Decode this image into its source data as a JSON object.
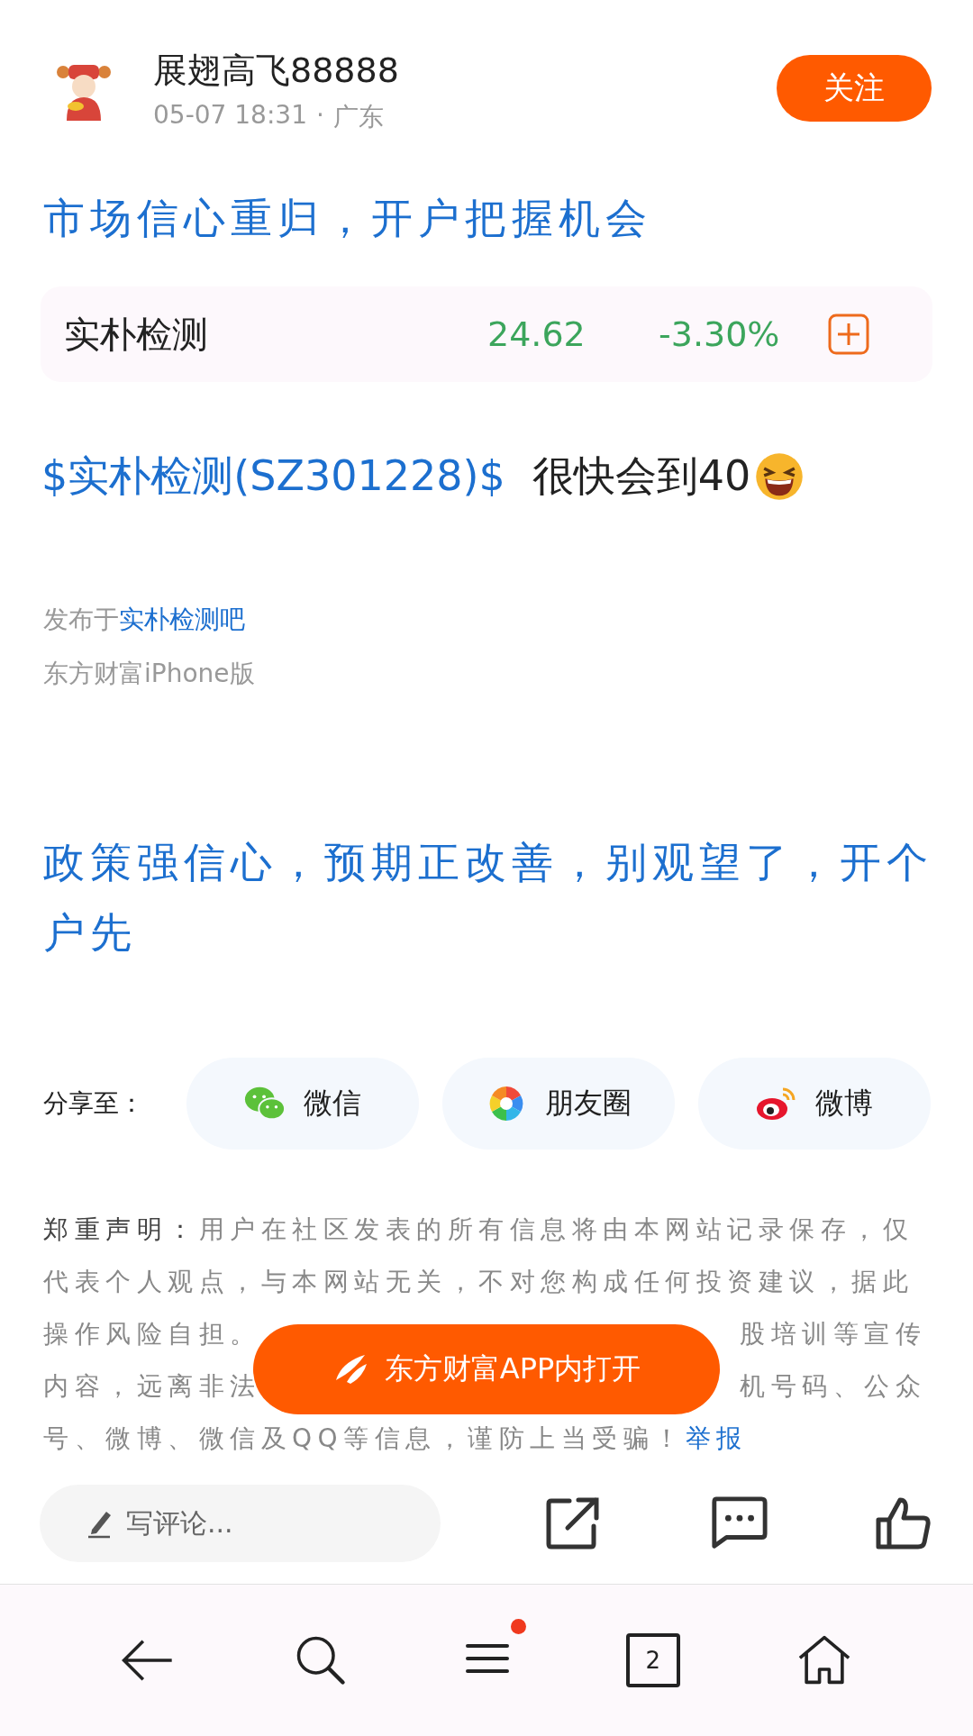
{
  "author": {
    "name": "展翅高飞88888",
    "time": "05-07 18:31",
    "separator": "·",
    "location": "广东",
    "follow_label": "关注"
  },
  "title": "市场信心重归，开户把握机会",
  "stock_card": {
    "name": "实朴检测",
    "price": "24.62",
    "change": "-3.30%"
  },
  "post": {
    "stock_link": "$实朴检测(SZ301228)$",
    "text": "很快会到40"
  },
  "posted_in": {
    "prefix": "发布于",
    "forum": "实朴检测吧"
  },
  "source": "东方财富iPhone版",
  "promo_title": "政策强信心，预期正改善，别观望了，开个户先",
  "share": {
    "label": "分享至：",
    "targets": [
      {
        "kind": "wechat",
        "label": "微信"
      },
      {
        "kind": "moments",
        "label": "朋友圈"
      },
      {
        "kind": "weibo",
        "label": "微博"
      }
    ]
  },
  "disclaimer": {
    "heading": "郑重声明：",
    "text": "用户在社区发表的所有信息将由本网站记录保存，仅代表个人观点，与本网站无关，不对您构成任何投资建议，据此",
    "lines": [
      {
        "kind": "covered",
        "left": "操作风险自担。",
        "right": "股培训等宣传"
      },
      {
        "kind": "covered",
        "left": "内容，远离非法",
        "right": "机号码、公众"
      },
      {
        "kind": "full",
        "text": "号、微博、微信及QQ等信息，谨防上当受骗！"
      }
    ],
    "report_link": "举报"
  },
  "open_in_app_button": "东方财富APP内打开",
  "comment_field": {
    "placeholder": "写评论..."
  },
  "bottom_nav": {
    "tab_count": "2",
    "menu_has_badge": true
  }
}
